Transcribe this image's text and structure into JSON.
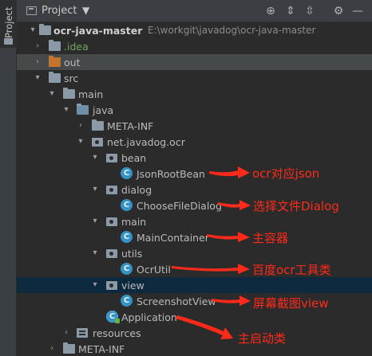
{
  "sidebar_tab": {
    "label": "Project"
  },
  "header": {
    "title": "Project",
    "caret": "▼",
    "buttons": [
      {
        "name": "locate-icon",
        "glyph": "⊕"
      },
      {
        "name": "expand-all-icon",
        "glyph": "⇕"
      },
      {
        "name": "collapse-all-icon",
        "glyph": "⇳"
      },
      {
        "name": "settings-icon",
        "glyph": "⚙"
      },
      {
        "name": "hide-icon",
        "glyph": "—"
      }
    ]
  },
  "tree": {
    "root": {
      "name": "ocr-java-master",
      "path": "E:\\workgit\\javadog\\ocr-java-master"
    },
    "idea": ".idea",
    "out": "out",
    "src": "src",
    "main": "main",
    "java": "java",
    "meta_inf_inner": "META-INF",
    "package": "net.javadog.ocr",
    "bean": "bean",
    "json_root_bean": "JsonRootBean",
    "dialog": "dialog",
    "choose_file_dialog": "ChooseFileDialog",
    "main_pkg": "main",
    "main_container": "MainContainer",
    "utils": "utils",
    "ocr_util": "OcrUtil",
    "view": "view",
    "screenshot_view": "ScreenshotView",
    "application": "Application",
    "resources": "resources",
    "meta_inf_outer": "META-INF"
  },
  "annotations": {
    "json_root_bean": "ocr对应json",
    "choose_file_dialog": "选择文件Dialog",
    "main_container": "主容器",
    "ocr_util": "百度ocr工具类",
    "screenshot_view": "屏幕截图view",
    "application": "主启动类"
  },
  "colors": {
    "annotation": "#ff2a1a",
    "selected_row": "#0d293e",
    "class_icon": "#3592c4",
    "orange_folder": "#c4742c"
  }
}
